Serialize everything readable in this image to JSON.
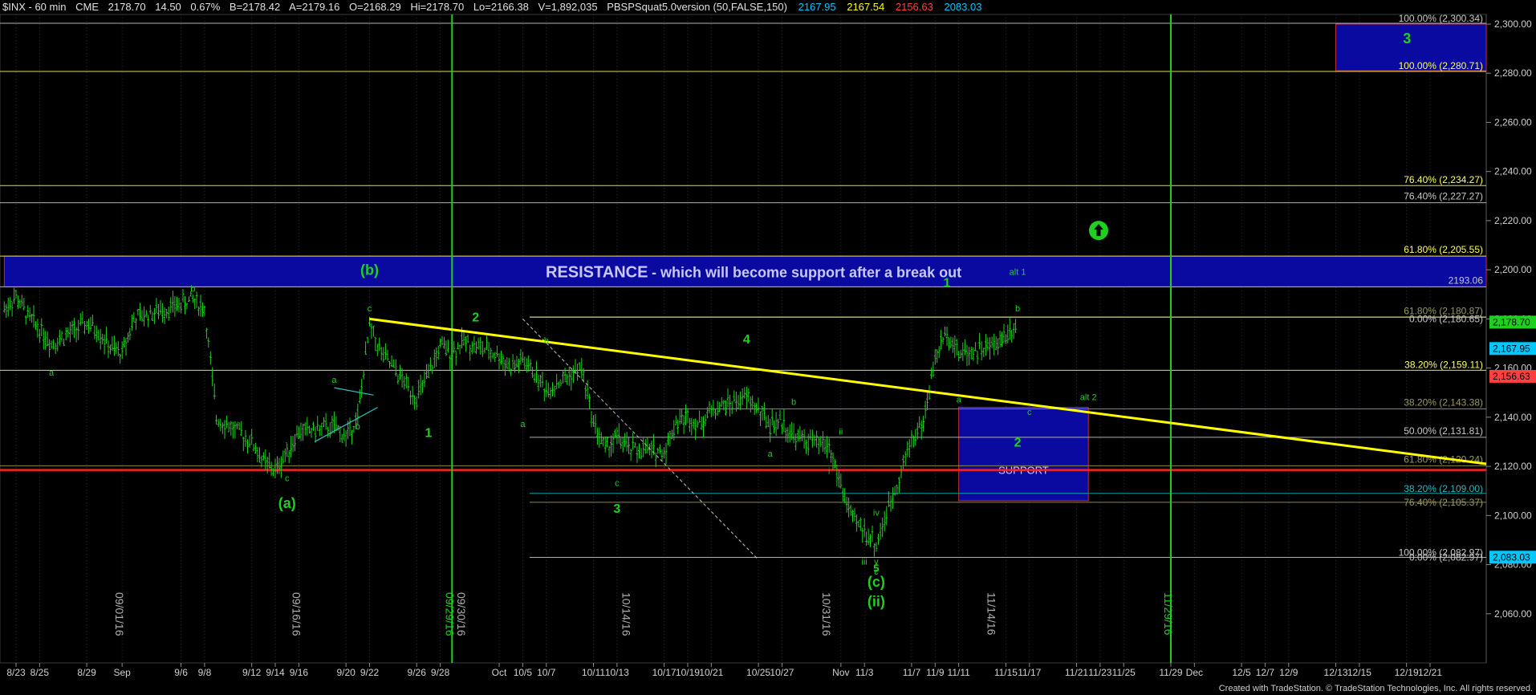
{
  "header": {
    "symbol": "$INX - 60 min",
    "exchange": "CME",
    "last": "2178.70",
    "change": "14.50",
    "change_pct": "0.67%",
    "bid": "B=2178.42",
    "ask": "A=2179.16",
    "open": "O=2168.29",
    "high": "Hi=2178.70",
    "low": "Lo=2166.38",
    "volume": "V=1,892,035",
    "study": "PBSPSquat5.0version (50,FALSE,150)",
    "study_values": [
      {
        "value": "2167.95",
        "color": "#00c8ff"
      },
      {
        "value": "2167.54",
        "color": "#ffff00"
      },
      {
        "value": "2156.63",
        "color": "#ff4040"
      },
      {
        "value": "2083.03",
        "color": "#00c8ff"
      }
    ]
  },
  "footer": {
    "credit": "Created with TradeStation. © TradeStation Technologies, Inc. All rights reserved."
  },
  "chart_data": {
    "type": "line",
    "instrument": "$INX - 60 min",
    "ylim": [
      2040,
      2300
    ],
    "y_ticks": [
      "2,060.00",
      "2,080.00",
      "2,100.00",
      "2,120.00",
      "2,140.00",
      "2,160.00",
      "2,180.00",
      "2,200.00",
      "2,220.00",
      "2,240.00",
      "2,260.00",
      "2,280.00",
      "2,300.00"
    ],
    "x_ticks": [
      "8/23",
      "8/25",
      "8/29",
      "Sep",
      "9/6",
      "9/8",
      "9/12",
      "9/14",
      "9/16",
      "9/20",
      "9/22",
      "9/26",
      "9/28",
      "Oct",
      "10/5",
      "10/7",
      "10/11",
      "10/13",
      "10/17",
      "10/19",
      "10/21",
      "10/25",
      "10/27",
      "Nov",
      "11/3",
      "11/7",
      "11/9",
      "11/11",
      "11/15",
      "11/17",
      "11/21",
      "11/23",
      "11/25",
      "11/29",
      "Dec",
      "12/5",
      "12/7",
      "12/9",
      "12/13",
      "12/15",
      "12/19",
      "12/21"
    ],
    "vertical_date_labels": [
      {
        "x": "9/1",
        "text": "09/01/16",
        "color": "#b0b0b0"
      },
      {
        "x": "9/16",
        "text": "09/16/16",
        "color": "#b0b0b0"
      },
      {
        "x": "9/29",
        "text": "09/29/16",
        "color": "#1fd11f"
      },
      {
        "x": "9/30",
        "text": "09/30/16",
        "color": "#b0b0b0"
      },
      {
        "x": "10/14",
        "text": "10/14/16",
        "color": "#b0b0b0"
      },
      {
        "x": "10/31",
        "text": "10/31/16",
        "color": "#b0b0b0"
      },
      {
        "x": "11/14",
        "text": "11/14/16",
        "color": "#b0b0b0"
      },
      {
        "x": "11/29",
        "text": "11/29/16",
        "color": "#1fd11f"
      }
    ],
    "vertical_lines": [
      {
        "x": "9/29",
        "color": "#1fd11f"
      },
      {
        "x": "11/29",
        "color": "#1fd11f"
      }
    ],
    "price_series": {
      "name": "$INX 60 min",
      "x": [
        "8/22",
        "8/23",
        "8/24",
        "8/25",
        "8/26",
        "8/29",
        "8/30",
        "8/31",
        "9/1",
        "9/2",
        "9/6",
        "9/7",
        "9/8",
        "9/9",
        "9/12",
        "9/13",
        "9/14",
        "9/15",
        "9/16",
        "9/19",
        "9/20",
        "9/21",
        "9/22",
        "9/23",
        "9/26",
        "9/27",
        "9/28",
        "9/29",
        "9/30",
        "10/3",
        "10/4",
        "10/5",
        "10/6",
        "10/7",
        "10/10",
        "10/11",
        "10/12",
        "10/13",
        "10/14",
        "10/17",
        "10/18",
        "10/19",
        "10/20",
        "10/21",
        "10/24",
        "10/25",
        "10/26",
        "10/27",
        "10/28",
        "10/31",
        "11/1",
        "11/2",
        "11/3",
        "11/4",
        "11/7",
        "11/8",
        "11/9",
        "11/10",
        "11/11",
        "11/14",
        "11/15",
        "11/16"
      ],
      "y": [
        2184,
        2189,
        2181,
        2176,
        2170,
        2178,
        2175,
        2168,
        2166,
        2180,
        2186,
        2188,
        2184,
        2140,
        2130,
        2122,
        2118,
        2126,
        2134,
        2136,
        2132,
        2140,
        2177,
        2166,
        2148,
        2157,
        2169,
        2166,
        2171,
        2165,
        2160,
        2163,
        2158,
        2151,
        2160,
        2138,
        2127,
        2132,
        2127,
        2126,
        2138,
        2140,
        2137,
        2143,
        2148,
        2143,
        2137,
        2138,
        2132,
        2128,
        2112,
        2098,
        2094,
        2088,
        2131,
        2138,
        2164,
        2175,
        2166,
        2169,
        2174,
        2178.7
      ]
    },
    "horizontal_levels": [
      {
        "label": "100.00% (2,300.34)",
        "value": 2300.34,
        "color": "#b0b0b0"
      },
      {
        "label": "100.00% (2,280.71)",
        "value": 2280.71,
        "color": "#e0e040"
      },
      {
        "label": "76.40% (2,234.27)",
        "value": 2234.27,
        "color": "#e0e040"
      },
      {
        "label": "76.40% (2,227.27)",
        "value": 2227.27,
        "color": "#b0b0b0"
      },
      {
        "label": "61.80% (2,205.55)",
        "value": 2205.55,
        "color": "#e0e040"
      },
      {
        "label": "2193.06",
        "value": 2193.06,
        "color": "#b0b0b0"
      },
      {
        "label": "61.80% (2,180.87)",
        "value": 2180.87,
        "color": "#888840"
      },
      {
        "label": "0.00% (2,180.65)",
        "value": 2180.65,
        "color": "#b0b0b0"
      },
      {
        "label": "38.20% (2,159.11)",
        "value": 2159.11,
        "color": "#e0e040"
      },
      {
        "label": "38.20% (2,143.38)",
        "value": 2143.38,
        "color": "#888840"
      },
      {
        "label": "50.00% (2,131.81)",
        "value": 2131.81,
        "color": "#b0b0b0"
      },
      {
        "label": "61.80% (2,120.24)",
        "value": 2120.24,
        "color": "#888840"
      },
      {
        "label": "38.20% (2,109.00)",
        "value": 2109.0,
        "color": "#00a0a0"
      },
      {
        "label": "76.40% (2,105.37)",
        "value": 2105.37,
        "color": "#888840"
      },
      {
        "label": "100.00% (2,082.97)",
        "value": 2082.97,
        "color": "#b0b0b0"
      },
      {
        "label": "0.00% (2,082.97)",
        "value": 2082.97,
        "color": "#b0b0b0"
      }
    ],
    "support_line": {
      "value": 2118.5,
      "color": "#ff2020"
    },
    "trendline": {
      "from": [
        "9/22",
        2180
      ],
      "to": [
        "12/26",
        2121
      ],
      "color": "#ffff00"
    },
    "boxes": [
      {
        "name": "resistance",
        "label": "RESISTANCE",
        "sublabel": "- which will become support after a break out",
        "y_range": [
          2193.06,
          2205.55
        ],
        "x_range": [
          "8/22",
          "12/26"
        ],
        "color": "#0a0aa0"
      },
      {
        "name": "support",
        "label": "SUPPORT",
        "y_range": [
          2106,
          2144
        ],
        "x_range": [
          "11/11",
          "11/22"
        ],
        "color": "#0a0aa0"
      },
      {
        "name": "target-3",
        "label": "3",
        "y_range": [
          2281,
          2300
        ],
        "x_range": [
          "12/13",
          "12/26"
        ],
        "color": "#0a0aa0"
      }
    ],
    "price_tags": [
      {
        "value": "2,178.70",
        "y": 2178.7,
        "bg": "#1fd11f",
        "fg": "#000000"
      },
      {
        "value": "2,167.95",
        "y": 2167.95,
        "bg": "#00c8ff",
        "fg": "#000000"
      },
      {
        "value": "2,156.63",
        "y": 2156.63,
        "bg": "#ff4040",
        "fg": "#000000"
      },
      {
        "value": "2,083.03",
        "y": 2083.03,
        "bg": "#00c8ff",
        "fg": "#000000"
      }
    ],
    "wave_labels": [
      {
        "text": "(b)",
        "x": "9/22",
        "y": 2198,
        "size": "large"
      },
      {
        "text": "(a)",
        "x": "9/15",
        "y": 2103,
        "size": "large"
      },
      {
        "text": "(c)",
        "x": "11/4",
        "y": 2071,
        "size": "large"
      },
      {
        "text": "(ii)",
        "x": "11/4",
        "y": 2063,
        "size": "large"
      },
      {
        "text": "1",
        "x": "9/27",
        "y": 2132,
        "size": "medium"
      },
      {
        "text": "2",
        "x": "10/1",
        "y": 2179,
        "size": "medium"
      },
      {
        "text": "3",
        "x": "10/13",
        "y": 2101,
        "size": "medium"
      },
      {
        "text": "4",
        "x": "10/24",
        "y": 2170,
        "size": "medium"
      },
      {
        "text": "5",
        "x": "11/4",
        "y": 2077,
        "size": "small"
      },
      {
        "text": "1",
        "x": "11/10",
        "y": 2193,
        "size": "medium"
      },
      {
        "text": "2",
        "x": "11/16",
        "y": 2128,
        "size": "medium"
      },
      {
        "text": "alt 1",
        "x": "11/16",
        "y": 2198,
        "size": "faint"
      },
      {
        "text": "alt 2",
        "x": "11/22",
        "y": 2147,
        "size": "faint"
      },
      {
        "text": "a",
        "x": "8/26",
        "y": 2157
      },
      {
        "text": "b",
        "x": "9/7",
        "y": 2191
      },
      {
        "text": "c",
        "x": "9/15",
        "y": 2114
      },
      {
        "text": "a",
        "x": "9/19",
        "y": 2154
      },
      {
        "text": "b",
        "x": "9/21",
        "y": 2135
      },
      {
        "text": "c",
        "x": "9/22",
        "y": 2183
      },
      {
        "text": "a",
        "x": "10/5",
        "y": 2136
      },
      {
        "text": "b",
        "x": "10/7",
        "y": 2170
      },
      {
        "text": "c",
        "x": "10/13",
        "y": 2112
      },
      {
        "text": "a",
        "x": "10/26",
        "y": 2124
      },
      {
        "text": "b",
        "x": "10/28",
        "y": 2145
      },
      {
        "text": "i",
        "x": "10/31",
        "y": 2117
      },
      {
        "text": "ii",
        "x": "11/1",
        "y": 2133
      },
      {
        "text": "iii",
        "x": "11/3",
        "y": 2080
      },
      {
        "text": "iv",
        "x": "11/4",
        "y": 2100
      },
      {
        "text": "v",
        "x": "11/4",
        "y": 2080
      },
      {
        "text": "c",
        "x": "11/4",
        "y": 2076
      },
      {
        "text": "a",
        "x": "11/11",
        "y": 2146
      },
      {
        "text": "b",
        "x": "11/16",
        "y": 2183
      },
      {
        "text": "c",
        "x": "11/17",
        "y": 2141
      }
    ],
    "arrow_icon": {
      "name": "up-arrow-icon",
      "x": "11/29",
      "y": 2216,
      "color": "#1fd11f"
    }
  }
}
